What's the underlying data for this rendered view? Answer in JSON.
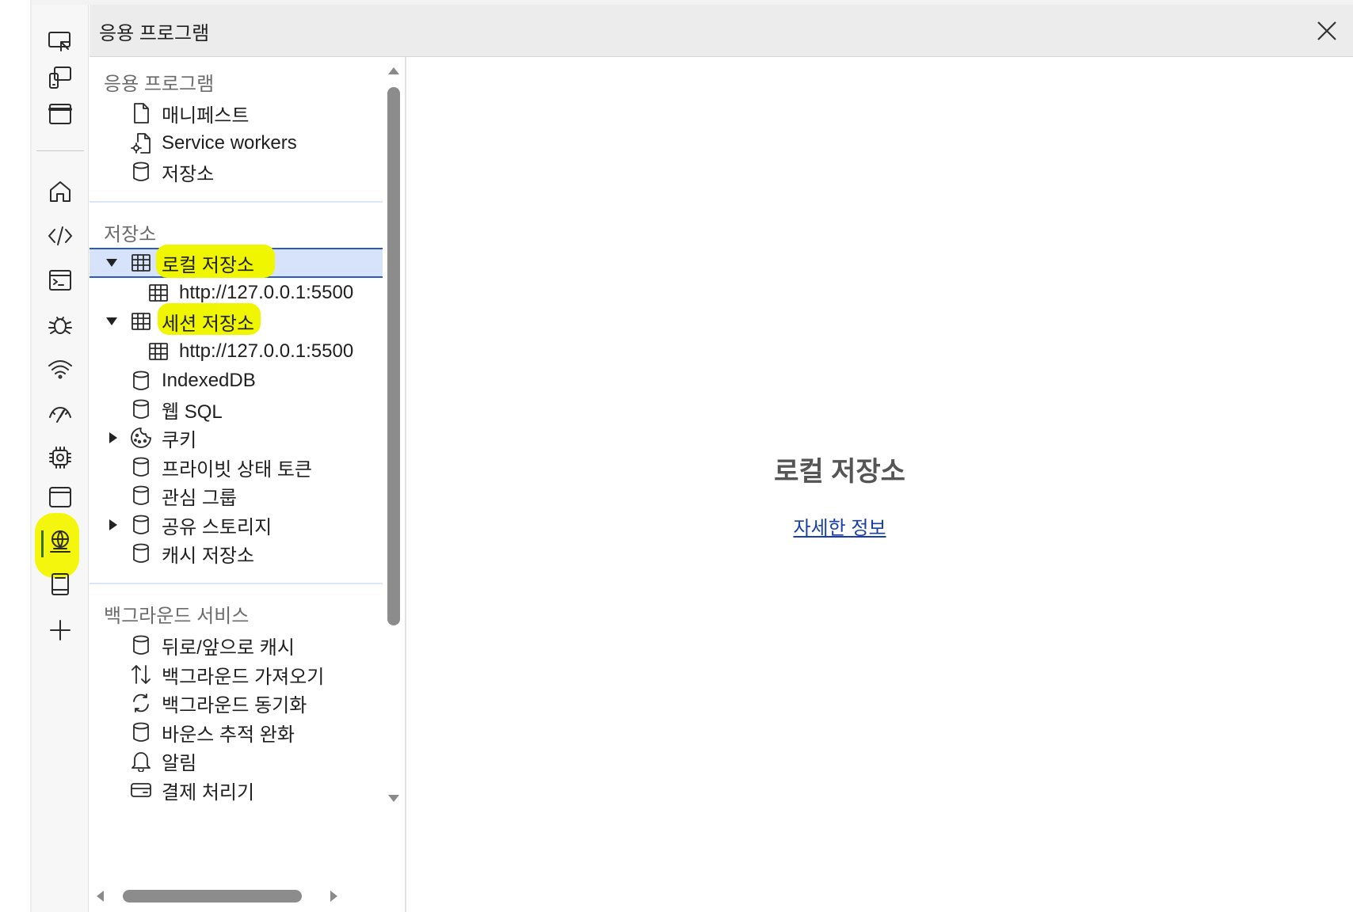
{
  "header": {
    "title": "응용 프로그램"
  },
  "sections": {
    "application": {
      "title": "응용 프로그램",
      "items": [
        {
          "label": "매니페스트",
          "icon": "file-icon"
        },
        {
          "label": "Service workers",
          "icon": "gear-file-icon"
        },
        {
          "label": "저장소",
          "icon": "database-icon"
        }
      ]
    },
    "storage": {
      "title": "저장소",
      "items": [
        {
          "label": "로컬 저장소",
          "icon": "table-icon",
          "expanded": true,
          "selected": true
        },
        {
          "label": "http://127.0.0.1:5500",
          "icon": "table-icon"
        },
        {
          "label": "세션 저장소",
          "icon": "table-icon",
          "expanded": true
        },
        {
          "label": "http://127.0.0.1:5500",
          "icon": "table-icon"
        },
        {
          "label": "IndexedDB",
          "icon": "database-icon"
        },
        {
          "label": "웹 SQL",
          "icon": "database-icon"
        },
        {
          "label": "쿠키",
          "icon": "cookie-icon",
          "expanded": false
        },
        {
          "label": "프라이빗 상태 토큰",
          "icon": "database-icon"
        },
        {
          "label": "관심 그룹",
          "icon": "database-icon"
        },
        {
          "label": "공유 스토리지",
          "icon": "database-icon",
          "expanded": false
        },
        {
          "label": "캐시 저장소",
          "icon": "database-icon"
        }
      ]
    },
    "background": {
      "title": "백그라운드 서비스",
      "items": [
        {
          "label": "뒤로/앞으로 캐시",
          "icon": "database-icon"
        },
        {
          "label": "백그라운드 가져오기",
          "icon": "up-down-arrows-icon"
        },
        {
          "label": "백그라운드 동기화",
          "icon": "sync-icon"
        },
        {
          "label": "바운스 추적 완화",
          "icon": "database-icon"
        },
        {
          "label": "알림",
          "icon": "bell-icon"
        },
        {
          "label": "결제 처리기",
          "icon": "card-icon"
        }
      ]
    }
  },
  "main": {
    "title": "로컬 저장소",
    "link": "자세한 정보"
  },
  "colors": {
    "highlight": "#f0f500",
    "selected_bg": "#d6e3fb",
    "selected_border": "#2d5bb5",
    "link": "#1a3faa"
  }
}
